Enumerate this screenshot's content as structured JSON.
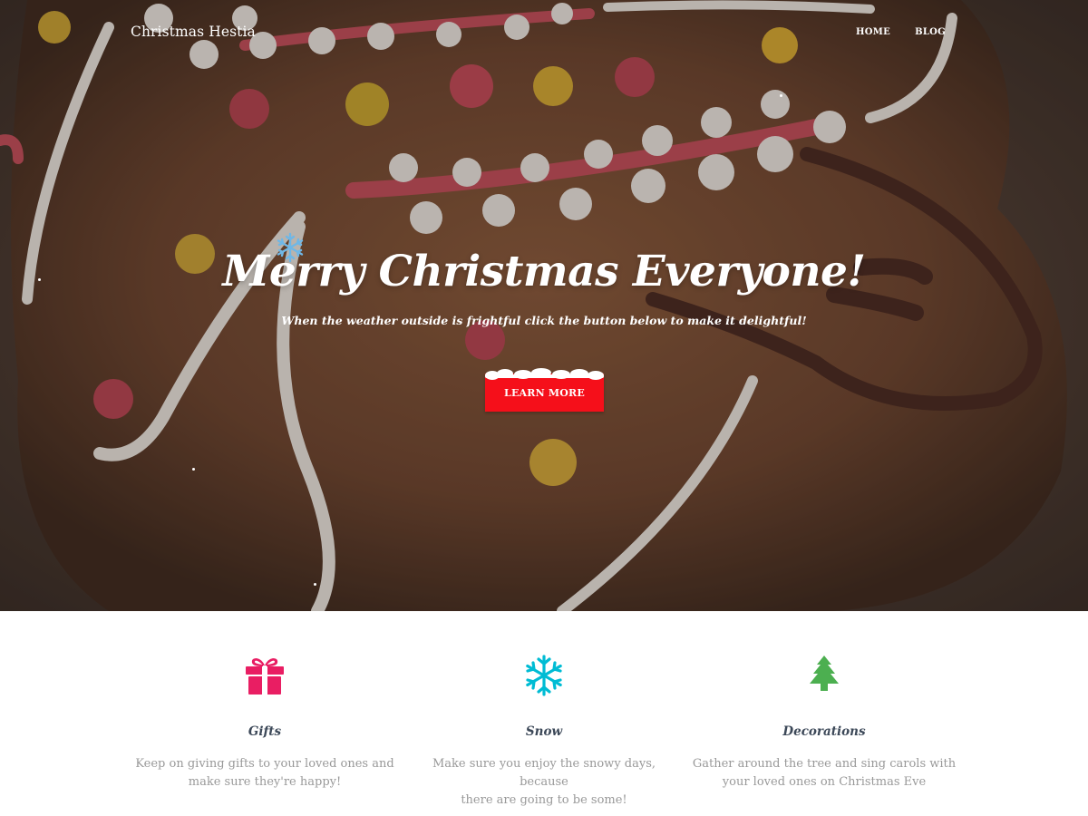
{
  "navbar": {
    "brand": "Christmas Hestia",
    "links": [
      "HOME",
      "BLOG"
    ]
  },
  "hero": {
    "title": "Merry Christmas Everyone!",
    "subtitle": "When the weather outside is frightful click the button below to make it delightful!",
    "button_label": "LEARN MORE"
  },
  "features": [
    {
      "icon": "gift-icon",
      "title": "Gifts",
      "text_line1": "Keep on giving gifts to your loved ones and",
      "text_line2": "make sure they're happy!",
      "color": "#e91e63"
    },
    {
      "icon": "snowflake-icon",
      "title": "Snow",
      "text_line1": "Make sure you enjoy the snowy days, because",
      "text_line2": "there are going to be some!",
      "color": "#00bcd4"
    },
    {
      "icon": "tree-icon",
      "title": "Decorations",
      "text_line1": "Gather around the tree and sing carols with",
      "text_line2": "your loved ones on Christmas Eve",
      "color": "#4caf50"
    }
  ],
  "colors": {
    "accent_button": "#f50f1a",
    "heading_text": "#3c4858",
    "body_text": "#999999"
  }
}
